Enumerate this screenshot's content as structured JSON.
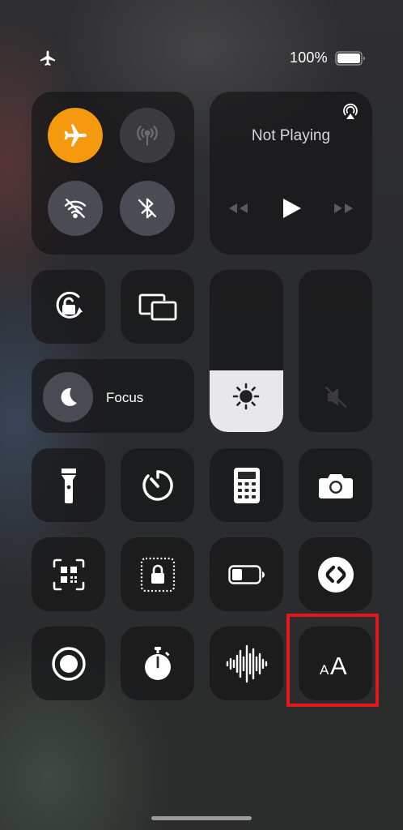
{
  "status_bar": {
    "mode_icon": "airplane-icon",
    "battery_percent": "100%",
    "battery_level": 1.0
  },
  "connectivity": {
    "airplane_mode": {
      "icon": "airplane-icon",
      "state": "on",
      "color": "#f59a0f"
    },
    "cellular_data": {
      "icon": "antenna-icon",
      "state": "disabled"
    },
    "wifi": {
      "icon": "wifi-off-icon",
      "state": "off"
    },
    "bluetooth": {
      "icon": "bluetooth-off-icon",
      "state": "off"
    }
  },
  "now_playing": {
    "title": "Not Playing",
    "controls": [
      "rewind-icon",
      "play-icon",
      "fast-forward-icon"
    ],
    "airplay_icon": "airplay-icon"
  },
  "controls_row1": {
    "orientation_lock": {
      "icon": "rotation-lock-icon"
    },
    "screen_mirroring": {
      "icon": "screen-mirroring-icon"
    }
  },
  "focus": {
    "label": "Focus",
    "icon": "moon-icon"
  },
  "brightness": {
    "level": 0.38,
    "icon": "sun-icon"
  },
  "volume": {
    "level": 0.0,
    "icon": "speaker-muted-icon"
  },
  "grid_row1": [
    {
      "name": "flashlight",
      "icon": "flashlight-icon"
    },
    {
      "name": "timer",
      "icon": "timer-icon"
    },
    {
      "name": "calculator",
      "icon": "calculator-icon"
    },
    {
      "name": "camera",
      "icon": "camera-icon"
    }
  ],
  "grid_row2": [
    {
      "name": "code-scanner",
      "icon": "qr-scanner-icon"
    },
    {
      "name": "guided-access",
      "icon": "guided-access-lock-icon"
    },
    {
      "name": "low-power-mode",
      "icon": "battery-icon"
    },
    {
      "name": "shazam",
      "icon": "shazam-icon"
    }
  ],
  "grid_row3": [
    {
      "name": "screen-recording",
      "icon": "record-icon"
    },
    {
      "name": "stopwatch",
      "icon": "stopwatch-icon"
    },
    {
      "name": "sound-recognition",
      "icon": "waveform-icon"
    },
    {
      "name": "text-size",
      "icon": "text-size-icon",
      "label": "AA"
    }
  ],
  "highlight": {
    "target": "text-size",
    "color": "#e6161a"
  }
}
